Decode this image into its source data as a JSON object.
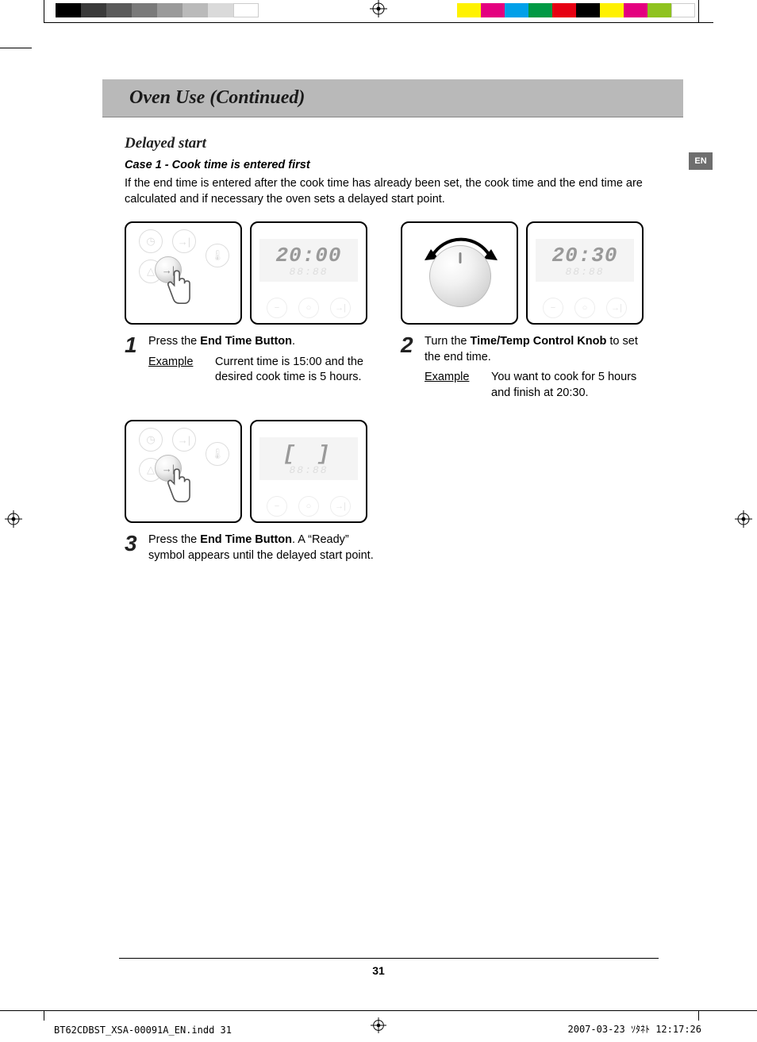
{
  "title": "Oven Use (Continued)",
  "lang_tab": "EN",
  "subheading": "Delayed start",
  "case_label": "Case 1 - Cook time is entered first",
  "intro": "If the end time is entered after the cook time has already been set, the cook time and the end time are calculated and if necessary the oven sets a delayed start point.",
  "steps": {
    "s1": {
      "num": "1",
      "text_pre": "Press the ",
      "text_bold": "End Time Button",
      "text_post": ".",
      "example_label": "Example",
      "example_text": "Current time is 15:00 and the desired cook time is 5 hours.",
      "display": "20:00",
      "display_sub": "88:88"
    },
    "s2": {
      "num": "2",
      "text_pre": "Turn the ",
      "text_bold": "Time/Temp Control Knob",
      "text_post": " to set the end time.",
      "example_label": "Example",
      "example_text": "You want to cook for 5 hours and finish at 20:30.",
      "display": "20:30",
      "display_sub": "88:88"
    },
    "s3": {
      "num": "3",
      "text_pre": "Press the ",
      "text_bold": "End Time Button",
      "text_post": ". A “Ready” symbol appears until the delayed start point.",
      "display": "[  ]",
      "display_sub": "88:88"
    }
  },
  "page_number": "31",
  "footer": {
    "file": "BT62CDBST_XSA-00091A_EN.indd   31",
    "date": "2007-03-23   ｿﾀﾈﾄ 12:17:26"
  },
  "colors": {
    "grays": [
      "#000000",
      "#3a3a3a",
      "#5a5a5a",
      "#7a7a7a",
      "#9a9a9a",
      "#bababa",
      "#dadada",
      "#ffffff"
    ],
    "bars": [
      "#fff200",
      "#e4007f",
      "#00a0e9",
      "#009944",
      "#e60012",
      "#920783",
      "#fff100",
      "#e4007f",
      "#8fc31f",
      "#ffffff"
    ]
  }
}
